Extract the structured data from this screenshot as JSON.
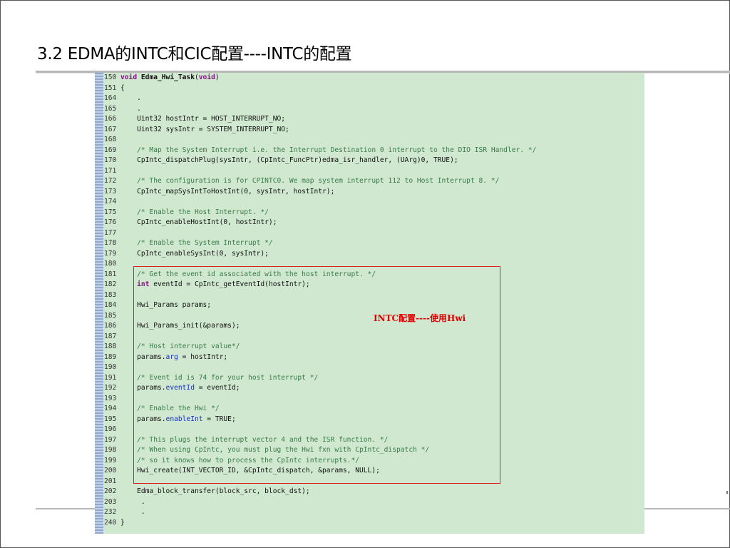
{
  "slide": {
    "title": "3.2 EDMA的INTC和CIC配置----INTC的配置"
  },
  "annotation": {
    "label": "INTC配置----使用Hwi"
  },
  "code": [
    {
      "num": "150",
      "text": "",
      "parts": [
        {
          "t": "void",
          "c": "kw"
        },
        {
          "t": " ",
          "c": "ct"
        },
        {
          "t": "Edma_Hwi_Task",
          "c": "fn-bold"
        },
        {
          "t": "(",
          "c": "ct"
        },
        {
          "t": "void",
          "c": "kw"
        },
        {
          "t": ")",
          "c": "ct"
        }
      ]
    },
    {
      "num": "151",
      "parts": [
        {
          "t": "{",
          "c": "ct"
        }
      ]
    },
    {
      "num": "164",
      "parts": [
        {
          "t": "    .",
          "c": "ct"
        }
      ]
    },
    {
      "num": "165",
      "parts": [
        {
          "t": "    .",
          "c": "ct"
        }
      ]
    },
    {
      "num": "166",
      "parts": [
        {
          "t": "    Uint32 hostIntr = HOST_INTERRUPT_NO;",
          "c": "ct"
        }
      ]
    },
    {
      "num": "167",
      "parts": [
        {
          "t": "    Uint32 sysIntr = SYSTEM_INTERRUPT_NO;",
          "c": "ct"
        }
      ]
    },
    {
      "num": "168",
      "parts": []
    },
    {
      "num": "169",
      "parts": [
        {
          "t": "    /* Map the System Interrupt i.e. the Interrupt Destination 0 interrupt to the DIO ISR Handler. */",
          "c": "cm"
        }
      ]
    },
    {
      "num": "170",
      "parts": [
        {
          "t": "    CpIntc_dispatchPlug(sysIntr, (CpIntc_FuncPtr)edma_isr_handler, (UArg)0, TRUE);",
          "c": "ct"
        }
      ]
    },
    {
      "num": "171",
      "parts": []
    },
    {
      "num": "172",
      "parts": [
        {
          "t": "    /* The configuration is for CPINTC0. We map system interrupt 112 to Host Interrupt 8. */",
          "c": "cm"
        }
      ]
    },
    {
      "num": "173",
      "parts": [
        {
          "t": "    CpIntc_mapSysIntToHostInt(0, sysIntr, hostIntr);",
          "c": "ct"
        }
      ]
    },
    {
      "num": "174",
      "parts": []
    },
    {
      "num": "175",
      "parts": [
        {
          "t": "    /* Enable the Host Interrupt. */",
          "c": "cm"
        }
      ]
    },
    {
      "num": "176",
      "parts": [
        {
          "t": "    CpIntc_enableHostInt(0, hostIntr);",
          "c": "ct"
        }
      ]
    },
    {
      "num": "177",
      "parts": []
    },
    {
      "num": "178",
      "parts": [
        {
          "t": "    /* Enable the System Interrupt */",
          "c": "cm"
        }
      ]
    },
    {
      "num": "179",
      "parts": [
        {
          "t": "    CpIntc_enableSysInt(0, sysIntr);",
          "c": "ct"
        }
      ]
    },
    {
      "num": "180",
      "parts": []
    },
    {
      "num": "181",
      "parts": [
        {
          "t": "    /* Get the event id associated with the host interrupt. */",
          "c": "cm"
        }
      ]
    },
    {
      "num": "182",
      "parts": [
        {
          "t": "    ",
          "c": "ct"
        },
        {
          "t": "int",
          "c": "kw"
        },
        {
          "t": " eventId = CpIntc_getEventId(hostIntr);",
          "c": "ct"
        }
      ]
    },
    {
      "num": "183",
      "parts": []
    },
    {
      "num": "184",
      "parts": [
        {
          "t": "    Hwi_Params params;",
          "c": "ct"
        }
      ]
    },
    {
      "num": "185",
      "parts": []
    },
    {
      "num": "186",
      "parts": [
        {
          "t": "    Hwi_Params_init(&params);",
          "c": "ct"
        }
      ]
    },
    {
      "num": "187",
      "parts": []
    },
    {
      "num": "188",
      "parts": [
        {
          "t": "    /* Host interrupt value*/",
          "c": "cm"
        }
      ]
    },
    {
      "num": "189",
      "parts": [
        {
          "t": "    params.",
          "c": "ct"
        },
        {
          "t": "arg",
          "c": "fd"
        },
        {
          "t": " = hostIntr;",
          "c": "ct"
        }
      ]
    },
    {
      "num": "190",
      "parts": []
    },
    {
      "num": "191",
      "parts": [
        {
          "t": "    /* Event id is 74 for your host interrupt */",
          "c": "cm"
        }
      ]
    },
    {
      "num": "192",
      "parts": [
        {
          "t": "    params.",
          "c": "ct"
        },
        {
          "t": "eventId",
          "c": "fd"
        },
        {
          "t": " = eventId;",
          "c": "ct"
        }
      ]
    },
    {
      "num": "193",
      "parts": []
    },
    {
      "num": "194",
      "parts": [
        {
          "t": "    /* Enable the Hwi */",
          "c": "cm"
        }
      ]
    },
    {
      "num": "195",
      "parts": [
        {
          "t": "    params.",
          "c": "ct"
        },
        {
          "t": "enableInt",
          "c": "fd"
        },
        {
          "t": " = TRUE;",
          "c": "ct"
        }
      ]
    },
    {
      "num": "196",
      "parts": []
    },
    {
      "num": "197",
      "parts": [
        {
          "t": "    /* This plugs the interrupt vector 4 and the ISR function. */",
          "c": "cm"
        }
      ]
    },
    {
      "num": "198",
      "parts": [
        {
          "t": "    /* When using CpIntc, you must plug the Hwi fxn with CpIntc_dispatch */",
          "c": "cm"
        }
      ]
    },
    {
      "num": "199",
      "parts": [
        {
          "t": "    /* so it knows how to process the CpIntc interrupts.*/",
          "c": "cm"
        }
      ]
    },
    {
      "num": "200",
      "parts": [
        {
          "t": "    Hwi_create(INT_VECTOR_ID, &CpIntc_dispatch, &params, NULL);",
          "c": "ct"
        }
      ]
    },
    {
      "num": "201",
      "parts": []
    },
    {
      "num": "202",
      "parts": [
        {
          "t": "    Edma_block_transfer(block_src, block_dst);",
          "c": "ct"
        }
      ]
    },
    {
      "num": "203",
      "parts": [
        {
          "t": "     .",
          "c": "ct"
        }
      ]
    },
    {
      "num": "232",
      "parts": [
        {
          "t": "     .",
          "c": "ct"
        }
      ]
    },
    {
      "num": "240",
      "parts": [
        {
          "t": "}",
          "c": "ct"
        }
      ]
    }
  ]
}
